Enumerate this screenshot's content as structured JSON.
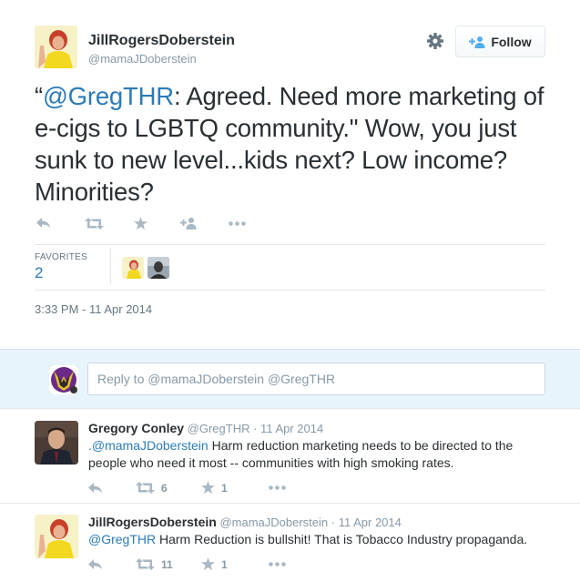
{
  "tweet": {
    "author_name": "JillRogersDoberstein",
    "author_handle": "@mamaJDoberstein",
    "follow_label": "Follow",
    "text_quote_open": "“",
    "text_mention": "@GregTHR",
    "text_body": ": Agreed. Need more marketing of e-cigs to LGBTQ community.\" Wow, you just sunk to new level...kids next?  Low income?  Minorities?",
    "stats_label": "FAVORITES",
    "favorites_count": "2",
    "timestamp": "3:33 PM - 11 Apr 2014"
  },
  "reply_box": {
    "placeholder": "Reply to @mamaJDoberstein @GregTHR"
  },
  "replies": [
    {
      "name": "Gregory Conley",
      "handle": "@GregTHR",
      "date": "· 11 Apr 2014",
      "mention": ".@mamaJDoberstein",
      "text": " Harm reduction marketing needs to be directed to the people who need it most -- communities with high smoking rates.",
      "retweets": "6",
      "favorites": "1"
    },
    {
      "name": "JillRogersDoberstein",
      "handle": "@mamaJDoberstein",
      "date": "· 11 Apr 2014",
      "mention": "@GregTHR",
      "text": " Harm Reduction is bullshit!  That is Tobacco Industry propaganda.",
      "retweets": "11",
      "favorites": "1"
    }
  ],
  "colors": {
    "link": "#2b7bb9",
    "muted": "#8899a6",
    "text": "#292f33",
    "reply_bg": "#e8f4fb"
  },
  "icons": [
    "gear-icon",
    "follow-person-icon",
    "reply-icon",
    "retweet-icon",
    "favorite-star-icon",
    "follow-plus-icon",
    "more-dots-icon"
  ]
}
